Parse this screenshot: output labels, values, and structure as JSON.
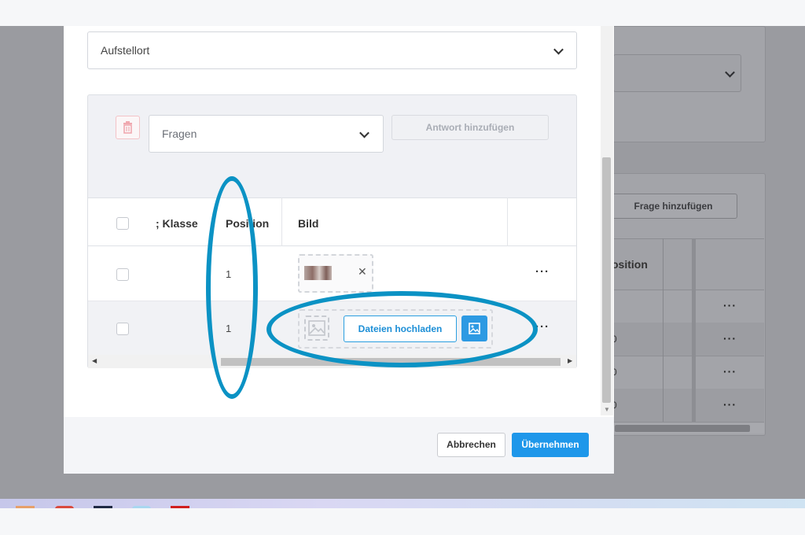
{
  "modal": {
    "aufstellort_select": {
      "value": "Aufstellort"
    },
    "fragen_select": {
      "placeholder": "Fragen"
    },
    "add_answer_label": "Antwort hinzufügen",
    "table": {
      "columns": {
        "klasse": "; Klasse",
        "position": "Position",
        "bild": "Bild"
      },
      "rows": [
        {
          "position": "1",
          "has_image": true
        },
        {
          "position": "1",
          "has_image": false
        }
      ],
      "upload_label": "Dateien hochladen"
    },
    "footer": {
      "cancel_label": "Abbrechen",
      "ok_label": "Übernehmen"
    }
  },
  "background": {
    "add_question_label": "Frage hinzufügen",
    "column_position": "osition",
    "row_values": [
      "0",
      "0",
      "0"
    ]
  },
  "colors": {
    "primary": "#1e97ea",
    "annotation": "#0b92c4",
    "danger": "#f3c3c7"
  },
  "icons": [
    "trash-icon",
    "chevron-down-icon",
    "close-icon",
    "more-horizontal-icon",
    "image-icon",
    "image-picker-icon"
  ]
}
